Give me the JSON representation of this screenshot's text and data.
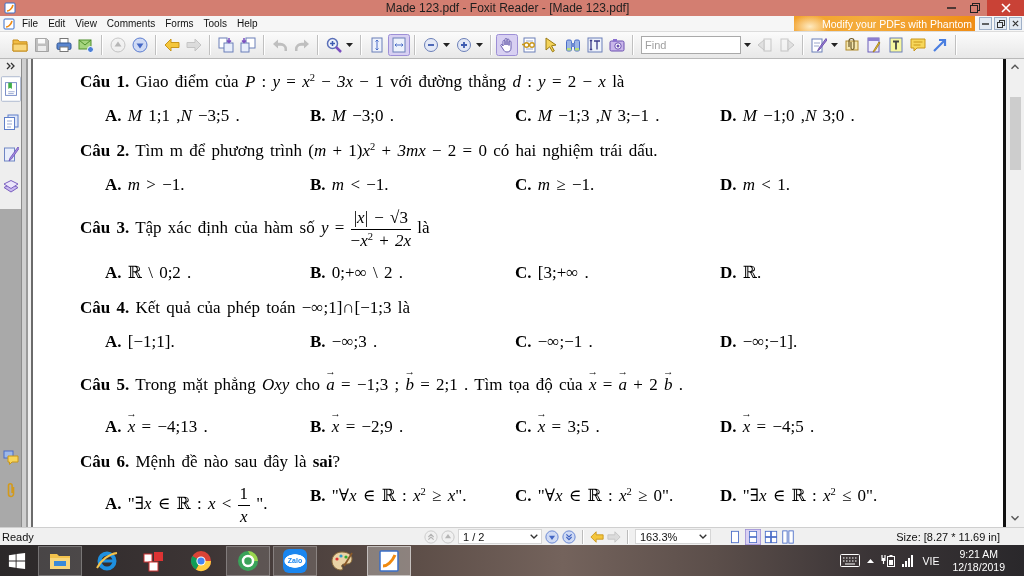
{
  "window": {
    "title": "Made 123.pdf - Foxit Reader - [Made 123.pdf]"
  },
  "menu_bar": {
    "items": [
      "File",
      "Edit",
      "View",
      "Comments",
      "Forms",
      "Tools",
      "Help"
    ],
    "banner": "Modify your PDFs with Phantom"
  },
  "toolbar": {
    "items": [
      {
        "kind": "folder",
        "disabled": false,
        "selected": false
      },
      {
        "kind": "save",
        "disabled": true,
        "selected": false
      },
      {
        "kind": "print",
        "disabled": false,
        "selected": false
      },
      {
        "kind": "email",
        "disabled": false,
        "selected": false
      },
      {
        "kind": "separator"
      },
      {
        "kind": "up",
        "disabled": true,
        "selected": false
      },
      {
        "kind": "down",
        "disabled": false,
        "selected": false
      },
      {
        "kind": "separator"
      },
      {
        "kind": "back",
        "disabled": false,
        "selected": false
      },
      {
        "kind": "forward",
        "disabled": true,
        "selected": false
      },
      {
        "kind": "separator"
      },
      {
        "kind": "extract",
        "disabled": false,
        "selected": false
      },
      {
        "kind": "insert",
        "disabled": false,
        "selected": false
      },
      {
        "kind": "separator"
      },
      {
        "kind": "undo",
        "disabled": true,
        "selected": false
      },
      {
        "kind": "redo",
        "disabled": true,
        "selected": false
      },
      {
        "kind": "separator"
      },
      {
        "kind": "magnifier",
        "disabled": false,
        "selected": false
      },
      {
        "kind": "caret"
      },
      {
        "kind": "separator"
      },
      {
        "kind": "fitpage",
        "disabled": false,
        "selected": false
      },
      {
        "kind": "fitwidth",
        "disabled": false,
        "selected": true
      },
      {
        "kind": "separator"
      },
      {
        "kind": "zoomout",
        "disabled": false,
        "selected": false
      },
      {
        "kind": "caret"
      },
      {
        "kind": "zoomin",
        "disabled": false,
        "selected": false
      },
      {
        "kind": "caret"
      },
      {
        "kind": "separator"
      },
      {
        "kind": "hand",
        "disabled": false,
        "selected": true
      },
      {
        "kind": "reader",
        "disabled": false,
        "selected": false
      },
      {
        "kind": "select",
        "disabled": false,
        "selected": false
      },
      {
        "kind": "binoculars",
        "disabled": false,
        "selected": false
      },
      {
        "kind": "textselect",
        "disabled": false,
        "selected": false
      },
      {
        "kind": "camera",
        "disabled": false,
        "selected": false
      },
      {
        "kind": "separator"
      },
      {
        "kind": "find",
        "placeholder": "Find"
      },
      {
        "kind": "caret"
      },
      {
        "kind": "findprev",
        "disabled": true,
        "selected": false
      },
      {
        "kind": "findnext",
        "disabled": true,
        "selected": false
      },
      {
        "kind": "separator"
      },
      {
        "kind": "pen",
        "disabled": false,
        "selected": false
      },
      {
        "kind": "caret"
      },
      {
        "kind": "clip",
        "disabled": false,
        "selected": false
      },
      {
        "kind": "highlight",
        "disabled": false,
        "selected": false
      },
      {
        "kind": "typewriter",
        "disabled": false,
        "selected": false
      },
      {
        "kind": "note",
        "disabled": false,
        "selected": false
      },
      {
        "kind": "arrow",
        "disabled": false,
        "selected": false
      },
      {
        "kind": "separator"
      }
    ]
  },
  "nav_panel": {
    "top": [
      {
        "kind": "bookmarks",
        "selected": true
      },
      {
        "kind": "pages",
        "selected": false
      },
      {
        "kind": "signatures",
        "selected": false
      },
      {
        "kind": "layers",
        "selected": false
      }
    ],
    "bottom": [
      {
        "kind": "comments",
        "selected": false
      },
      {
        "kind": "attachments",
        "selected": false
      }
    ]
  },
  "document": {
    "questions": [
      {
        "content": [
          {
            "kind": "text",
            "value": "**Câu 1.** Giao điểm của *P* : *y* = *x*$^{2}$ − *3x* − 1 với đường thẳng *d* : *y* = 2 − *x* là"
          }
        ],
        "options": [
          {
            "label": "A.",
            "content": [
              {
                "kind": "text",
                "value": "*M* 1;1 ,*N* −3;5 ."
              }
            ]
          },
          {
            "label": "B.",
            "content": [
              {
                "kind": "text",
                "value": "*M* −3;0 ."
              }
            ]
          },
          {
            "label": "C.",
            "content": [
              {
                "kind": "text",
                "value": "*M* −1;3 ,*N* 3;−1 ."
              }
            ]
          },
          {
            "label": "D.",
            "content": [
              {
                "kind": "text",
                "value": "*M* −1;0 ,*N* 3;0 ."
              }
            ]
          }
        ]
      },
      {
        "content": [
          {
            "kind": "text",
            "value": "**Câu 2.** Tìm m để phương trình (*m* + 1)*x*$^{2}$ + *3mx* − 2 = 0 có hai nghiệm trái dấu."
          }
        ],
        "options": [
          {
            "label": "A.",
            "content": [
              {
                "kind": "text",
                "value": "*m* > −1."
              }
            ]
          },
          {
            "label": "B.",
            "content": [
              {
                "kind": "text",
                "value": "*m* < −1."
              }
            ]
          },
          {
            "label": "C.",
            "content": [
              {
                "kind": "text",
                "value": "*m* ≥ −1."
              }
            ]
          },
          {
            "label": "D.",
            "content": [
              {
                "kind": "text",
                "value": "*m* < 1."
              }
            ]
          }
        ]
      },
      {
        "content": [
          {
            "kind": "text",
            "value": "**Câu 3.** Tập xác định của hàm số *y* ="
          },
          {
            "kind": "fraction",
            "numerator": "|*x*| − √3",
            "denominator": "−*x*$^{2}$ + *2x*"
          },
          {
            "kind": "text",
            "value": "là"
          }
        ],
        "options": [
          {
            "label": "A.",
            "content": [
              {
                "kind": "text",
                "value": "ℝ \\ 0;2 ."
              }
            ]
          },
          {
            "label": "B.",
            "content": [
              {
                "kind": "text",
                "value": "0;+∞ \\ 2 ."
              }
            ]
          },
          {
            "label": "C.",
            "content": [
              {
                "kind": "text",
                "value": "[3;+∞ ."
              }
            ]
          },
          {
            "label": "D.",
            "content": [
              {
                "kind": "text",
                "value": "ℝ."
              }
            ]
          }
        ]
      },
      {
        "content": [
          {
            "kind": "text",
            "value": "**Câu 4.** Kết quả của phép toán −∞;1]∩[−1;3 là"
          }
        ],
        "options": [
          {
            "label": "A.",
            "content": [
              {
                "kind": "text",
                "value": "[−1;1]."
              }
            ]
          },
          {
            "label": "B.",
            "content": [
              {
                "kind": "text",
                "value": "−∞;3 ."
              }
            ]
          },
          {
            "label": "C.",
            "content": [
              {
                "kind": "text",
                "value": "−∞;−1 ."
              }
            ]
          },
          {
            "label": "D.",
            "content": [
              {
                "kind": "text",
                "value": "−∞;−1]."
              }
            ]
          }
        ]
      },
      {
        "content": [
          {
            "kind": "text",
            "value": "**Câu 5.** Trong mặt phẳng *Oxy* cho"
          },
          {
            "kind": "vector",
            "symbol": "*a*",
            "arrow": "→"
          },
          {
            "kind": "text",
            "value": "= −1;3 ;"
          },
          {
            "kind": "vector",
            "symbol": "*b*",
            "arrow": "→"
          },
          {
            "kind": "text",
            "value": "= 2;1 . Tìm tọa độ của"
          },
          {
            "kind": "vector",
            "symbol": "*x*",
            "arrow": "→"
          },
          {
            "kind": "text",
            "value": "="
          },
          {
            "kind": "vector",
            "symbol": "*a*",
            "arrow": "→"
          },
          {
            "kind": "text",
            "value": "+ 2"
          },
          {
            "kind": "vector",
            "symbol": "*b*",
            "arrow": "→"
          },
          {
            "kind": "text",
            "value": "."
          }
        ],
        "options": [
          {
            "label": "A.",
            "content": [
              {
                "kind": "vector",
                "symbol": "*x*",
                "arrow": "→"
              },
              {
                "kind": "text",
                "value": "= −4;13 ."
              }
            ]
          },
          {
            "label": "B.",
            "content": [
              {
                "kind": "vector",
                "symbol": "*x*",
                "arrow": "→"
              },
              {
                "kind": "text",
                "value": "= −2;9 ."
              }
            ]
          },
          {
            "label": "C.",
            "content": [
              {
                "kind": "vector",
                "symbol": "*x*",
                "arrow": "→"
              },
              {
                "kind": "text",
                "value": "= 3;5 ."
              }
            ]
          },
          {
            "label": "D.",
            "content": [
              {
                "kind": "vector",
                "symbol": "*x*",
                "arrow": "→"
              },
              {
                "kind": "text",
                "value": "= −4;5 ."
              }
            ]
          }
        ]
      },
      {
        "content": [
          {
            "kind": "text",
            "value": "**Câu 6.** Mệnh đề nào sau đây là **sai**?"
          }
        ],
        "options": [
          {
            "label": "A.",
            "content": [
              {
                "kind": "text",
                "value": "\"∃*x* ∈ ℝ : *x* <"
              },
              {
                "kind": "fraction",
                "numerator": "1",
                "denominator": "*x*"
              },
              {
                "kind": "text",
                "value": "\"."
              }
            ]
          },
          {
            "label": "B.",
            "content": [
              {
                "kind": "text",
                "value": "\"∀*x* ∈ ℝ : *x*$^{2}$ ≥ *x*\"."
              }
            ]
          },
          {
            "label": "C.",
            "content": [
              {
                "kind": "text",
                "value": "\"∀*x* ∈ ℝ : *x*$^{2}$ ≥ 0\"."
              }
            ]
          },
          {
            "label": "D.",
            "content": [
              {
                "kind": "text",
                "value": "\"∃*x* ∈ ℝ : *x*$^{2}$ ≤ 0\"."
              }
            ]
          }
        ]
      }
    ]
  },
  "status_bar": {
    "text": "Ready",
    "controls": [
      {
        "kind": "first",
        "disabled": true
      },
      {
        "kind": "previous",
        "disabled": true
      },
      {
        "kind": "pagefield",
        "value": "1 / 2"
      },
      {
        "kind": "next",
        "disabled": false
      },
      {
        "kind": "last",
        "disabled": false
      },
      {
        "kind": "separator"
      },
      {
        "kind": "back",
        "disabled": false
      },
      {
        "kind": "forward",
        "disabled": true
      },
      {
        "kind": "separator"
      },
      {
        "kind": "zoomfield",
        "value": "163.3%"
      },
      {
        "kind": "single",
        "selected": false
      },
      {
        "kind": "continuous",
        "selected": true
      },
      {
        "kind": "facing",
        "selected": false
      },
      {
        "kind": "continuousfacing",
        "selected": false
      }
    ],
    "size": "Size: [8.27 * 11.69 in]"
  },
  "taskbar": {
    "apps": [
      {
        "kind": "explorer",
        "running": true,
        "selected": false
      },
      {
        "kind": "ie",
        "running": false,
        "selected": false
      },
      {
        "kind": "unikey",
        "running": false,
        "selected": false
      },
      {
        "kind": "chrome",
        "running": false,
        "selected": false
      },
      {
        "kind": "coccoc",
        "running": true,
        "selected": false
      },
      {
        "kind": "zalo",
        "label": "Zalo",
        "running": true,
        "selected": false
      },
      {
        "kind": "paint",
        "running": false,
        "selected": false
      },
      {
        "kind": "foxit",
        "running": true,
        "selected": true
      }
    ],
    "tray": {
      "language": "VIE",
      "time": "9:21 AM",
      "date": "12/18/2019"
    }
  }
}
